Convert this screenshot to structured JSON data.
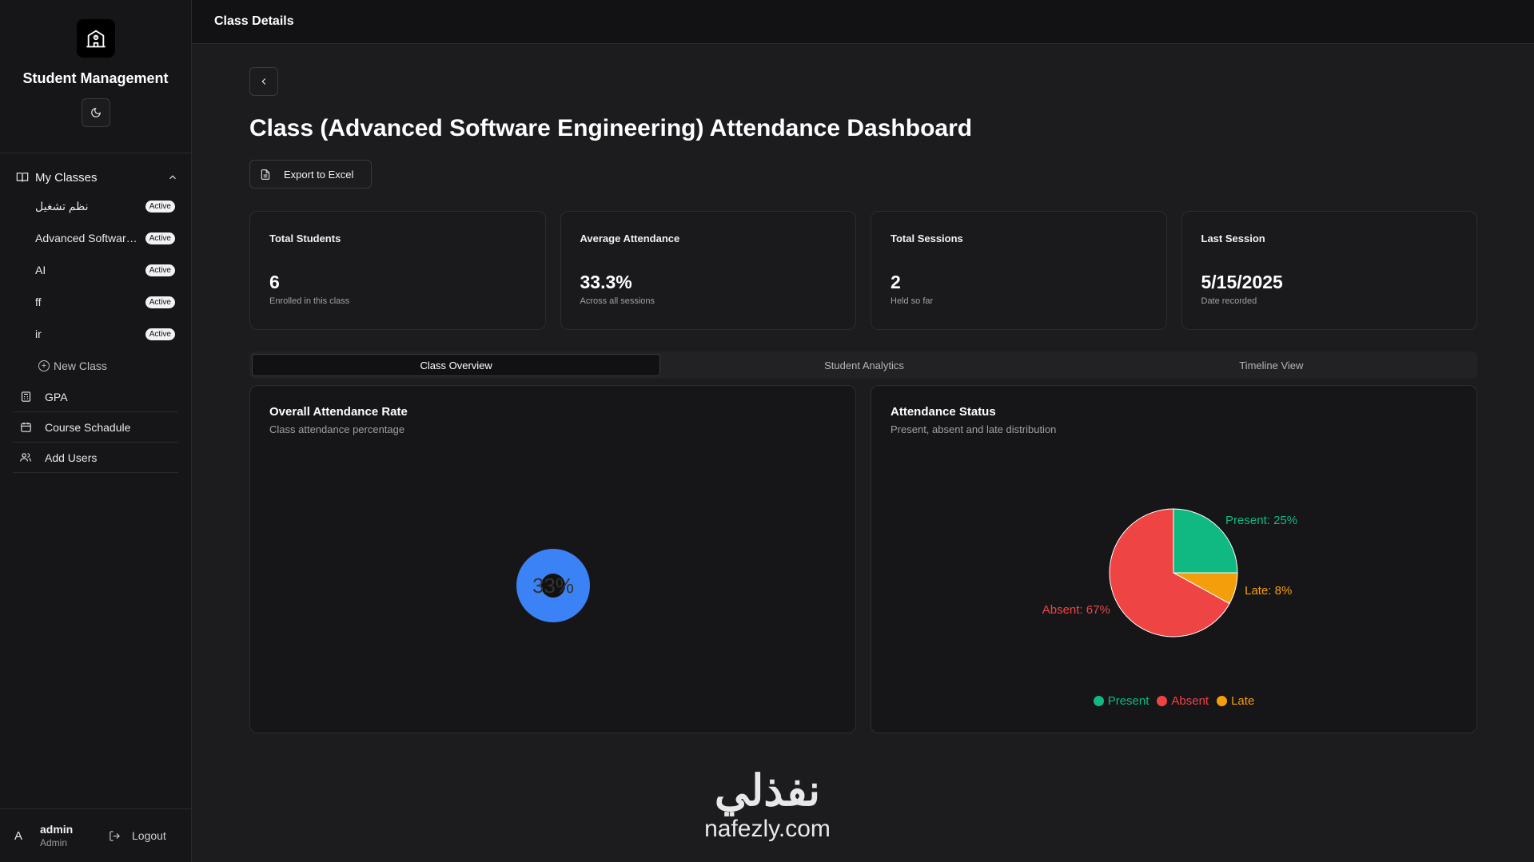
{
  "app": {
    "name": "Student Management"
  },
  "topbar": {
    "title": "Class Details"
  },
  "sidebar": {
    "section_label": "My Classes",
    "classes": [
      {
        "name": "نظم تشغيل",
        "status": "Active"
      },
      {
        "name": "Advanced Software Engineering",
        "status": "Active"
      },
      {
        "name": "AI",
        "status": "Active"
      },
      {
        "name": "ff",
        "status": "Active"
      },
      {
        "name": "ir",
        "status": "Active"
      }
    ],
    "new_class_label": "New Class",
    "nav": [
      {
        "label": "GPA",
        "icon": "calculator-icon"
      },
      {
        "label": "Course Schadule",
        "icon": "calendar-icon"
      },
      {
        "label": "Add Users",
        "icon": "users-icon"
      }
    ]
  },
  "user": {
    "avatar": "A",
    "name": "admin",
    "role": "Admin",
    "logout_label": "Logout"
  },
  "page": {
    "title": "Class (Advanced Software Engineering) Attendance Dashboard",
    "export_label": "Export to Excel"
  },
  "stats": [
    {
      "label": "Total Students",
      "value": "6",
      "sub": "Enrolled in this class"
    },
    {
      "label": "Average Attendance",
      "value": "33.3%",
      "sub": "Across all sessions"
    },
    {
      "label": "Total Sessions",
      "value": "2",
      "sub": "Held so far"
    },
    {
      "label": "Last Session",
      "value": "5/15/2025",
      "sub": "Date recorded"
    }
  ],
  "tabs": [
    "Class Overview",
    "Student Analytics",
    "Timeline View"
  ],
  "active_tab": 0,
  "rate_panel": {
    "title": "Overall Attendance Rate",
    "subtitle": "Class attendance percentage",
    "value_label": "33%",
    "fill_color": "#3b82f6"
  },
  "status_panel": {
    "title": "Attendance Status",
    "subtitle": "Present, absent and late distribution"
  },
  "chart_data": {
    "type": "pie",
    "title": "Attendance Status",
    "categories": [
      "Present",
      "Absent",
      "Late"
    ],
    "values": [
      25,
      67,
      8
    ],
    "labels": [
      "Present: 25%",
      "Absent: 67%",
      "Late: 8%"
    ],
    "colors": [
      "#10b981",
      "#ef4444",
      "#f59e0b"
    ],
    "legend": "bottom"
  },
  "watermark": {
    "arabic": "نفذلي",
    "latin": "nafezly.com"
  }
}
